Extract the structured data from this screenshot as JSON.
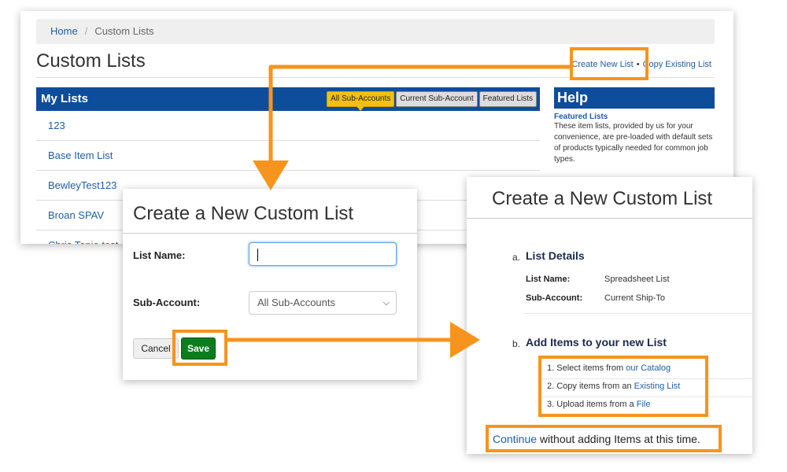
{
  "background_page": {
    "breadcrumb": {
      "home": "Home",
      "separator": "/",
      "current": "Custom Lists"
    },
    "title": "Custom Lists",
    "actions": {
      "create_new": "Create New List",
      "bullet": "•",
      "copy_existing": "Copy Existing List"
    },
    "my_lists": {
      "header": "My Lists",
      "filters": [
        "All Sub-Accounts",
        "Current Sub-Account",
        "Featured Lists"
      ],
      "active_filter": "All Sub-Accounts",
      "items": [
        "123",
        "Base Item List",
        "BewleyTest123",
        "Broan SPAV",
        "Chris Tapia test"
      ]
    },
    "help": {
      "header": "Help",
      "subheader": "Featured Lists",
      "text": "These item lists, provided by us for your convenience, are pre-loaded with default sets of products typically needed for common job types."
    }
  },
  "create_dialog": {
    "title": "Create a New Custom List",
    "list_name_label": "List Name:",
    "list_name_value": "",
    "sub_account_label": "Sub-Account:",
    "sub_account_selected": "All Sub-Accounts",
    "cancel_label": "Cancel",
    "save_label": "Save"
  },
  "confirmation_dialog": {
    "title": "Create a New Custom List",
    "section_a": {
      "letter": "a.",
      "title": "List Details",
      "list_name_label": "List Name:",
      "list_name_value": "Spreadsheet List",
      "sub_account_label": "Sub-Account:",
      "sub_account_value": "Current Ship-To"
    },
    "section_b": {
      "letter": "b.",
      "title": "Add Items to your new List",
      "steps": [
        {
          "num": "1.",
          "text": "Select items from ",
          "link": "our Catalog"
        },
        {
          "num": "2.",
          "text": "Copy items from an ",
          "link": "Existing List"
        },
        {
          "num": "3.",
          "text": "Upload items from a ",
          "link": "File"
        }
      ]
    },
    "continue_link": "Continue",
    "continue_text": " without adding Items at this time."
  },
  "colors": {
    "highlight": "#f7941d",
    "header_blue": "#0e4d9c",
    "link_blue": "#1f5ea8",
    "save_green": "#0b7d1e",
    "active_filter": "#f2c014"
  }
}
